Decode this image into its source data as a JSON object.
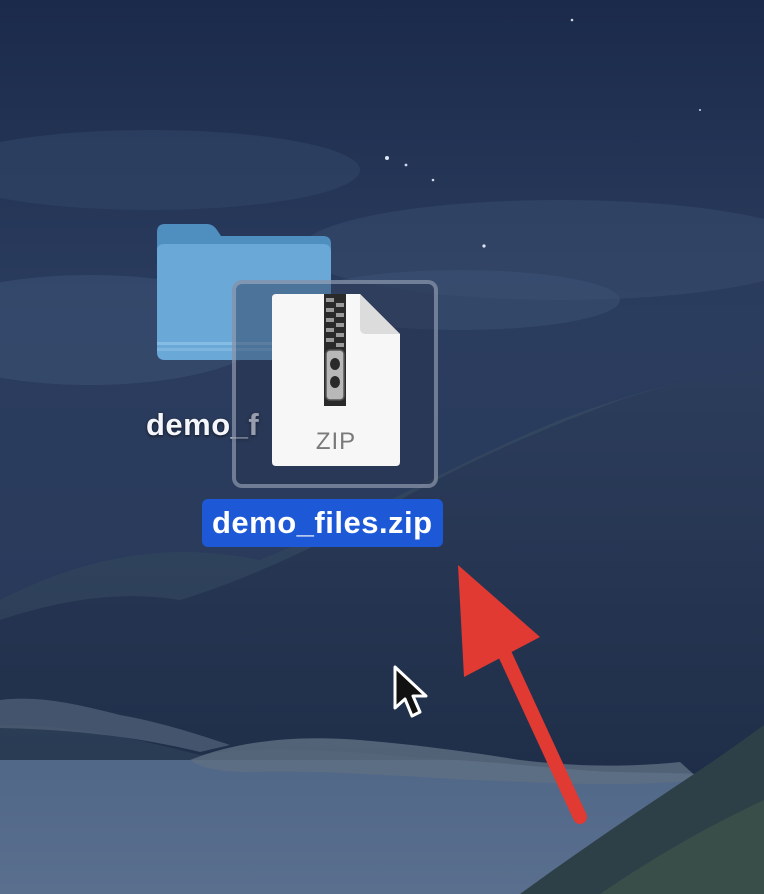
{
  "desktop": {
    "items": [
      {
        "kind": "folder",
        "icon": "folder-icon",
        "label": "demo_f",
        "selected": false,
        "color": "#6aa8d8"
      },
      {
        "kind": "file",
        "icon": "zip-file-icon",
        "icon_text": "ZIP",
        "label": "demo_files.zip",
        "selected": true,
        "selection_color": "#1d59d6"
      }
    ]
  },
  "annotation": {
    "type": "arrow",
    "color": "#e03a33",
    "points_to": "demo_files.zip"
  },
  "cursor": {
    "icon": "pointer-cursor-icon"
  }
}
